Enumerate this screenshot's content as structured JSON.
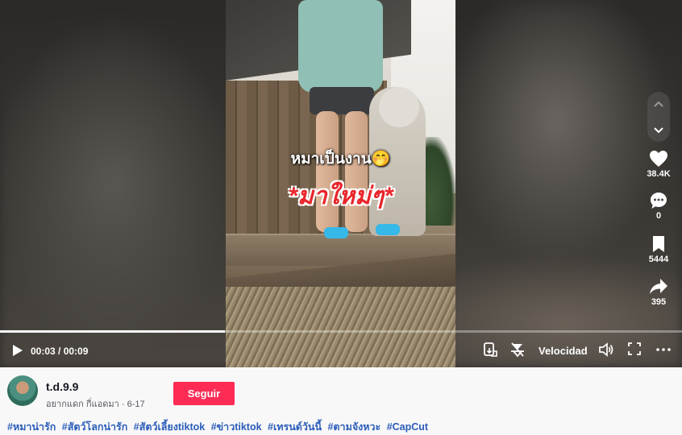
{
  "video": {
    "caption_line1": "หมาเป็นงาน🤭",
    "caption_line2": "*มาใหม่ๆ*",
    "progress": 0.33
  },
  "controls": {
    "time": "00:03 / 00:09",
    "speed_label": "Velocidad"
  },
  "sidebar": {
    "likes": "38.4K",
    "comments": "0",
    "saves": "5444",
    "shares": "395"
  },
  "author": {
    "username": "t.d.9.9",
    "nickname": "อยากแดก กี่แอดมา",
    "separator": "·",
    "date": "6-17",
    "follow_label": "Seguir"
  },
  "hashtags": [
    "#หมาน่ารัก",
    "#สัตว์โลกน่ารัก",
    "#สัตว์เลี้ยงtiktok",
    "#ข่าวtiktok",
    "#เทรนด์วันนี้",
    "#ตามจังหวะ",
    "#CapCut"
  ],
  "icons": [
    "play-icon",
    "autoscroll-icon",
    "floating-player-icon",
    "volume-icon",
    "fullscreen-icon",
    "more-icon",
    "chevron-up-icon",
    "chevron-down-icon",
    "heart-icon",
    "comment-icon",
    "bookmark-icon",
    "share-icon"
  ],
  "colors": {
    "follow_button": "#fe2c55",
    "hashtag": "#2b5db9",
    "caption_red": "#e8262b"
  }
}
